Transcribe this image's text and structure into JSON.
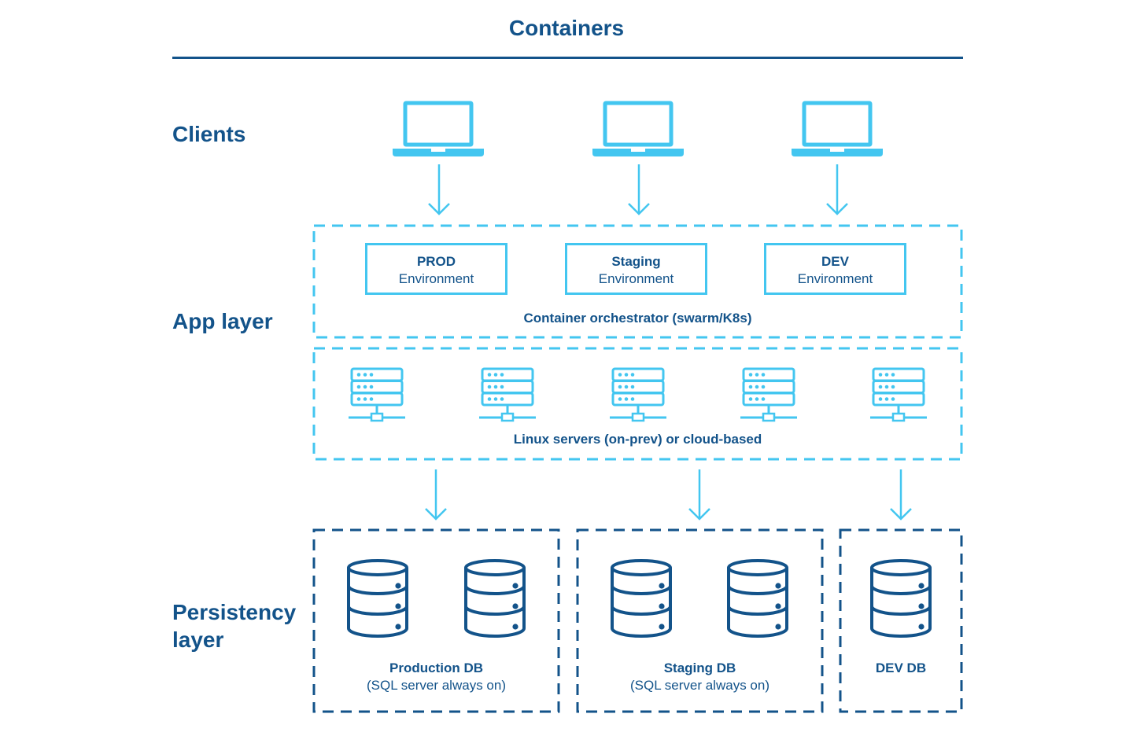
{
  "title": "Containers",
  "colors": {
    "primary": "#13538a",
    "accent": "#43c6f0"
  },
  "layers": {
    "clients": {
      "label": "Clients",
      "icon": "laptop-icon",
      "count": 3
    },
    "app": {
      "label": "App layer",
      "environments": [
        {
          "name": "PROD",
          "sub": "Environment"
        },
        {
          "name": "Staging",
          "sub": "Environment"
        },
        {
          "name": "DEV",
          "sub": "Environment"
        }
      ],
      "orchestrator_caption": "Container orchestrator (swarm/K8s)",
      "servers_caption": "Linux servers (on-prev) or cloud-based",
      "server_icon": "server-rack-icon",
      "server_count": 5
    },
    "persistency": {
      "label_line1": "Persistency",
      "label_line2": "layer",
      "groups": [
        {
          "name": "Production DB",
          "sub": "(SQL server always on)",
          "db_count": 2
        },
        {
          "name": "Staging DB",
          "sub": "(SQL server always on)",
          "db_count": 2
        },
        {
          "name": "DEV DB",
          "sub": "",
          "db_count": 1
        }
      ],
      "db_icon": "database-icon"
    }
  }
}
